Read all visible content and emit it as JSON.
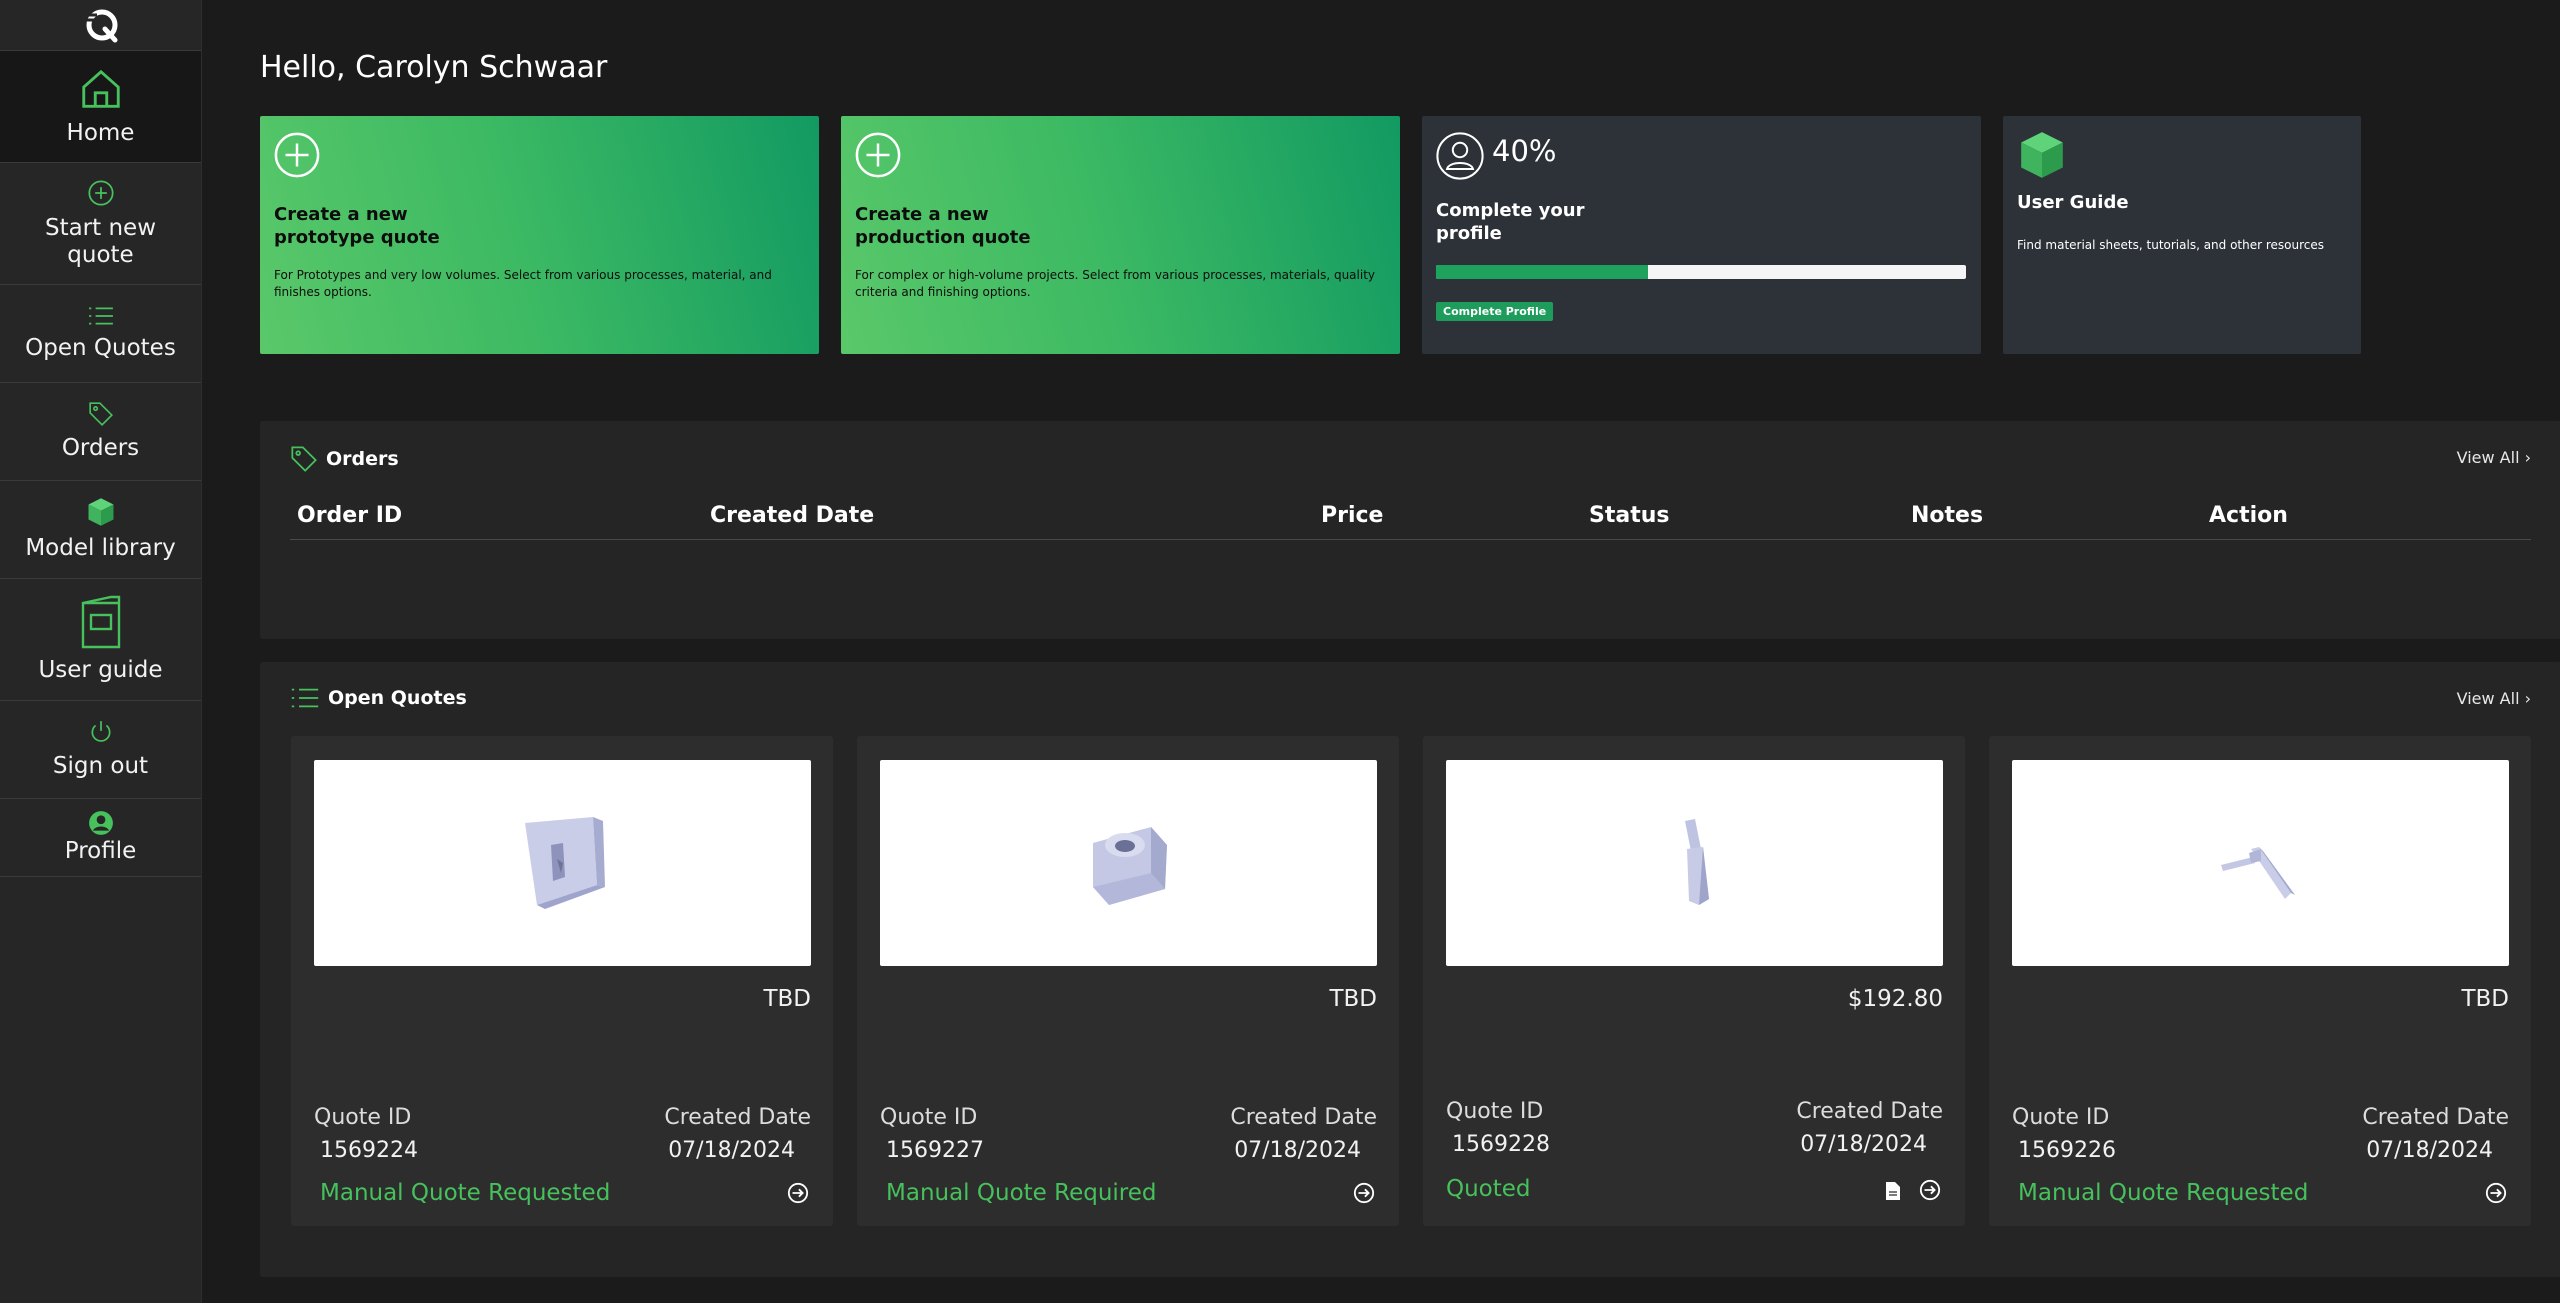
{
  "sidebar": {
    "items": [
      {
        "label": "Home",
        "icon": "home-icon"
      },
      {
        "label": "Start new quote",
        "icon": "plus-circle-icon"
      },
      {
        "label": "Open Quotes",
        "icon": "list-icon"
      },
      {
        "label": "Orders",
        "icon": "tag-icon"
      },
      {
        "label": "Model library",
        "icon": "cube-icon"
      },
      {
        "label": "User guide",
        "icon": "book-icon"
      },
      {
        "label": "Sign out",
        "icon": "power-icon"
      },
      {
        "label": "Profile",
        "icon": "user-circle-icon"
      }
    ]
  },
  "greeting": "Hello, Carolyn Schwaar",
  "cards": {
    "prototype": {
      "title": "Create a new prototype quote",
      "desc": "For Prototypes and very low volumes. Select from various processes, material, and finishes options."
    },
    "production": {
      "title": "Create a new production quote",
      "desc": "For complex or high-volume projects. Select from various processes, materials, quality criteria and finishing options."
    },
    "profile": {
      "percent": "40%",
      "progress": 0.4,
      "title": "Complete your profile",
      "button": "Complete Profile"
    },
    "guide": {
      "title": "User Guide",
      "desc": "Find material sheets, tutorials, and other resources"
    }
  },
  "orders": {
    "title": "Orders",
    "view_all": "View All ›",
    "columns": [
      "Order ID",
      "Created Date",
      "Price",
      "Status",
      "Notes",
      "Action"
    ]
  },
  "open_quotes": {
    "title": "Open Quotes",
    "view_all": "View All ›",
    "quote_id_label": "Quote ID",
    "created_label": "Created Date",
    "items": [
      {
        "price": "TBD",
        "id": "1569224",
        "date": "07/18/2024",
        "status": "Manual Quote Requested"
      },
      {
        "price": "TBD",
        "id": "1569227",
        "date": "07/18/2024",
        "status": "Manual Quote Required"
      },
      {
        "price": "$192.80",
        "id": "1569228",
        "date": "07/18/2024",
        "status": "Quoted"
      },
      {
        "price": "TBD",
        "id": "1569226",
        "date": "07/18/2024",
        "status": "Manual Quote Requested"
      }
    ]
  },
  "colors": {
    "accent": "#3dba63",
    "sidebar_bg": "#262626",
    "card_dark": "#2d3138",
    "status_green": "#46c15c"
  }
}
